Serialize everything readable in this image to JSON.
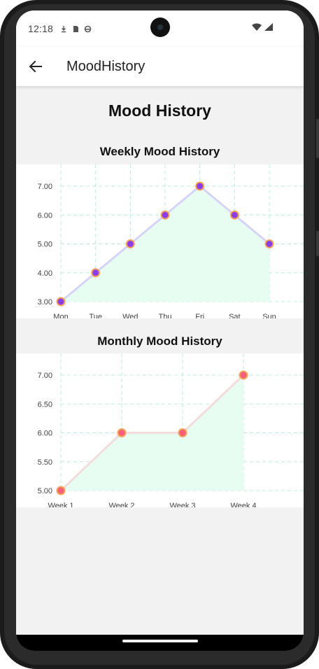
{
  "status_bar": {
    "time": "12:18",
    "icons": [
      "download-icon",
      "sd-card-icon",
      "sync-icon"
    ],
    "right_icons": [
      "wifi-icon",
      "signal-icon"
    ]
  },
  "app_bar": {
    "back_icon": "arrow-left-icon",
    "title": "MoodHistory"
  },
  "page_title": "Mood History",
  "colors": {
    "weekly_line": "#d6d4f6",
    "weekly_point_fill": "#8a3ee6",
    "point_stroke": "#f5a25a",
    "area_fill": "#e8fdf2",
    "monthly_line": "#f2dcdc",
    "monthly_point_fill": "#f4607a",
    "grid": "#b8ece0"
  },
  "chart_data": [
    {
      "type": "line",
      "title": "Weekly Mood History",
      "categories": [
        "Mon",
        "Tue",
        "Wed",
        "Thu",
        "Fri",
        "Sat",
        "Sun"
      ],
      "values": [
        3,
        4,
        5,
        6,
        7,
        6,
        5
      ],
      "y_ticks": [
        "3.00",
        "4.00",
        "5.00",
        "6.00",
        "7.00"
      ],
      "ylim": [
        3,
        7
      ],
      "area": true,
      "grid": true
    },
    {
      "type": "line",
      "title": "Monthly Mood History",
      "categories": [
        "Week 1",
        "Week 2",
        "Week 3",
        "Week 4"
      ],
      "values": [
        5,
        6,
        6,
        7
      ],
      "y_ticks": [
        "5.00",
        "5.50",
        "6.00",
        "6.50",
        "7.00"
      ],
      "ylim": [
        5,
        7
      ],
      "area": true,
      "grid": true
    }
  ]
}
